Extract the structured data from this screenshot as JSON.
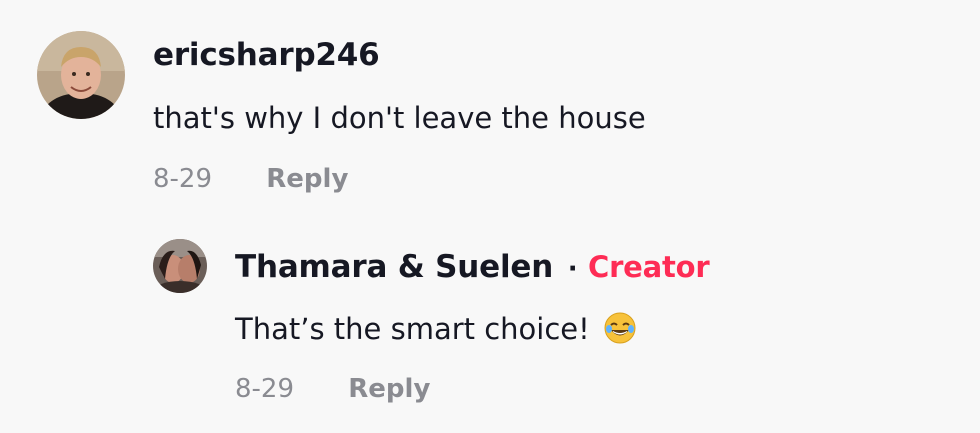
{
  "comment": {
    "username": "ericsharp246",
    "text": "that's why I don't leave the house",
    "date": "8-29",
    "reply_label": "Reply"
  },
  "reply": {
    "username": "Thamara & Suelen",
    "separator": "·",
    "badge": "Creator",
    "text": "That’s the smart choice!",
    "emoji": "face-with-tears-of-joy-emoji",
    "date": "8-29",
    "reply_label": "Reply"
  },
  "colors": {
    "background": "#f8f8f8",
    "text": "#161823",
    "meta": "#8a8b91",
    "creator_badge": "#fe2c55"
  }
}
